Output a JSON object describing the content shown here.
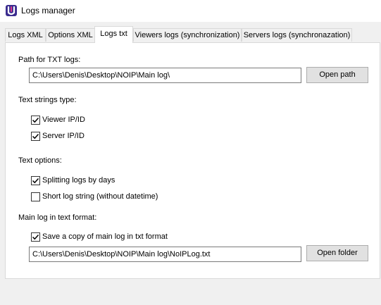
{
  "window": {
    "title": "Logs manager",
    "app_icon": "logs-manager-app-icon"
  },
  "tabs": [
    {
      "label": "Logs XML",
      "active": false
    },
    {
      "label": "Options XML",
      "active": false
    },
    {
      "label": "Logs txt",
      "active": true
    },
    {
      "label": "Viewers logs (synchronization)",
      "active": false
    },
    {
      "label": "Servers logs (synchronazation)",
      "active": false
    }
  ],
  "txt_logs": {
    "path_label": "Path for TXT logs:",
    "path_value": "C:\\Users\\Denis\\Desktop\\NOIP\\Main log\\",
    "open_path_label": "Open path"
  },
  "text_strings_type": {
    "heading": "Text strings type:",
    "viewer_label": "Viewer IP/ID",
    "viewer_checked": true,
    "server_label": "Server IP/ID",
    "server_checked": true
  },
  "text_options": {
    "heading": "Text options:",
    "split_label": "Splitting logs by days",
    "split_checked": true,
    "short_label": "Short log string (without datetime)",
    "short_checked": false
  },
  "main_log": {
    "heading": "Main log in text format:",
    "save_copy_label": "Save a copy of main log in txt format",
    "save_copy_checked": true,
    "file_value": "C:\\Users\\Denis\\Desktop\\NOIP\\Main log\\NoIPLog.txt",
    "open_folder_label": "Open folder"
  },
  "colors": {
    "accent": "#0060c0",
    "window_bg": "#f0f0f0",
    "panel_bg": "#ffffff"
  }
}
